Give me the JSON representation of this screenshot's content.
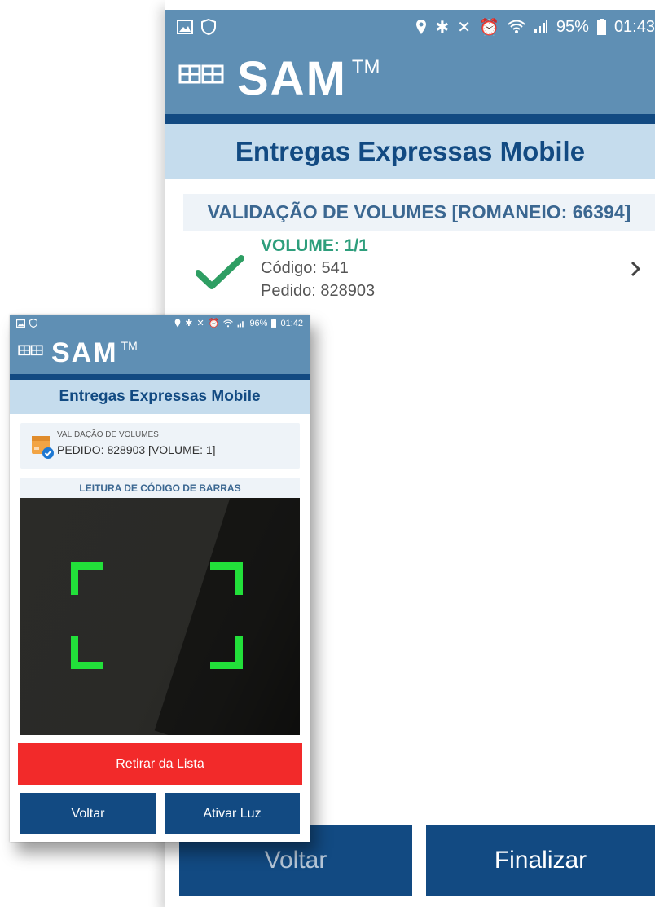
{
  "back_screen": {
    "status": {
      "battery": "95%",
      "time": "01:43"
    },
    "brand": {
      "name": "SAM",
      "tm": "TM"
    },
    "app_title": "Entregas Expressas Mobile",
    "section_title": "VALIDAÇÃO DE VOLUMES [ROMANEIO: 66394]",
    "items": [
      {
        "volume": "VOLUME: 1/1",
        "codigo": "Código: 541",
        "pedido": "Pedido: 828903"
      }
    ],
    "buttons": {
      "voltar": "Voltar",
      "finalizar": "Finalizar"
    }
  },
  "front_screen": {
    "status": {
      "battery": "96%",
      "time": "01:42"
    },
    "brand": {
      "name": "SAM",
      "tm": "TM"
    },
    "app_title": "Entregas Expressas Mobile",
    "card": {
      "label": "VALIDAÇÃO DE VOLUMES",
      "value": "PEDIDO: 828903 [VOLUME: 1]"
    },
    "scan_title": "LEITURA DE CÓDIGO DE BARRAS",
    "buttons": {
      "retirar": "Retirar da Lista",
      "voltar": "Voltar",
      "ativar_luz": "Ativar Luz"
    }
  },
  "colors": {
    "header_blue": "#5f8fb4",
    "dark_blue": "#124a82",
    "light_blue": "#c5dced",
    "success_green": "#2e9e7c",
    "danger_red": "#f22a2a",
    "scan_green": "#22e03a"
  },
  "icons": [
    "gallery-icon",
    "shield-icon",
    "location-icon",
    "bluetooth-icon",
    "mute-icon",
    "alarm-icon",
    "wifi-icon",
    "signal-icon",
    "battery-icon",
    "check-icon",
    "chevron-right-icon",
    "package-icon",
    "verified-badge-icon"
  ]
}
